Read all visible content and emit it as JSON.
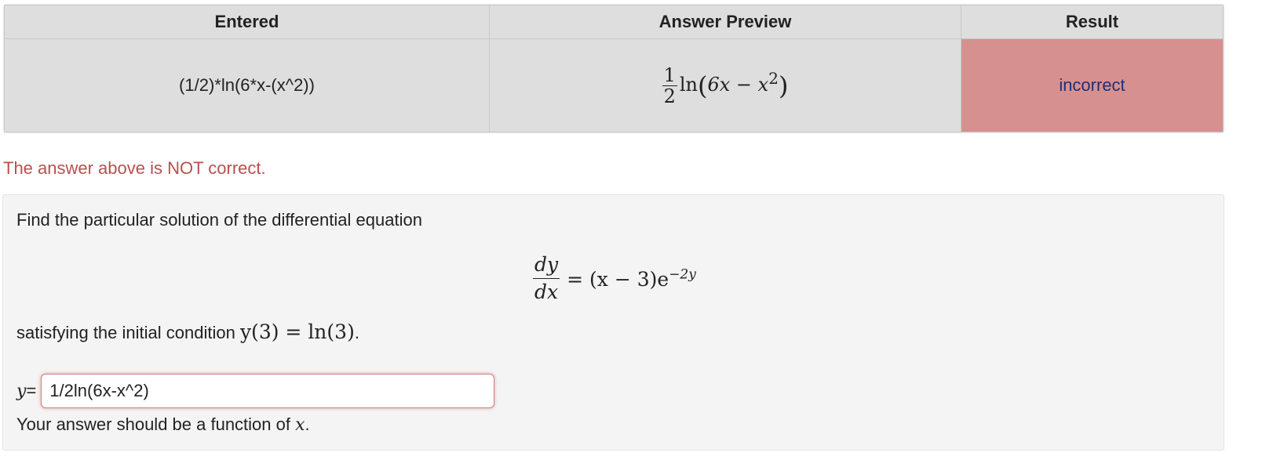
{
  "results_table": {
    "headers": {
      "entered": "Entered",
      "preview": "Answer Preview",
      "result": "Result"
    },
    "row": {
      "entered": "(1/2)*ln(6*x-(x^2))",
      "preview": {
        "frac_num": "1",
        "frac_den": "2",
        "func": "ln",
        "open": "(",
        "inner": "6x − x",
        "exp": "2",
        "close": ")"
      },
      "result": "incorrect"
    }
  },
  "status_message": "The answer above is NOT correct.",
  "problem": {
    "intro": "Find the particular solution of the differential equation",
    "equation": {
      "num": "dy",
      "den": "dx",
      "rhs": "= (x − 3)e",
      "exp": "−2y"
    },
    "condition_text": "satisfying the initial condition ",
    "condition_math": "y(3) = ln(3)",
    "condition_end": ".",
    "answer_label": "y",
    "answer_label_suffix": "=",
    "answer_value": "1/2ln(6x-x^2)",
    "hint_text": "Your answer should be a function of ",
    "hint_var": "x",
    "hint_end": "."
  },
  "colors": {
    "incorrect_bg": "#d69090",
    "incorrect_text": "#1f2f7a",
    "status_text": "#b85050"
  }
}
